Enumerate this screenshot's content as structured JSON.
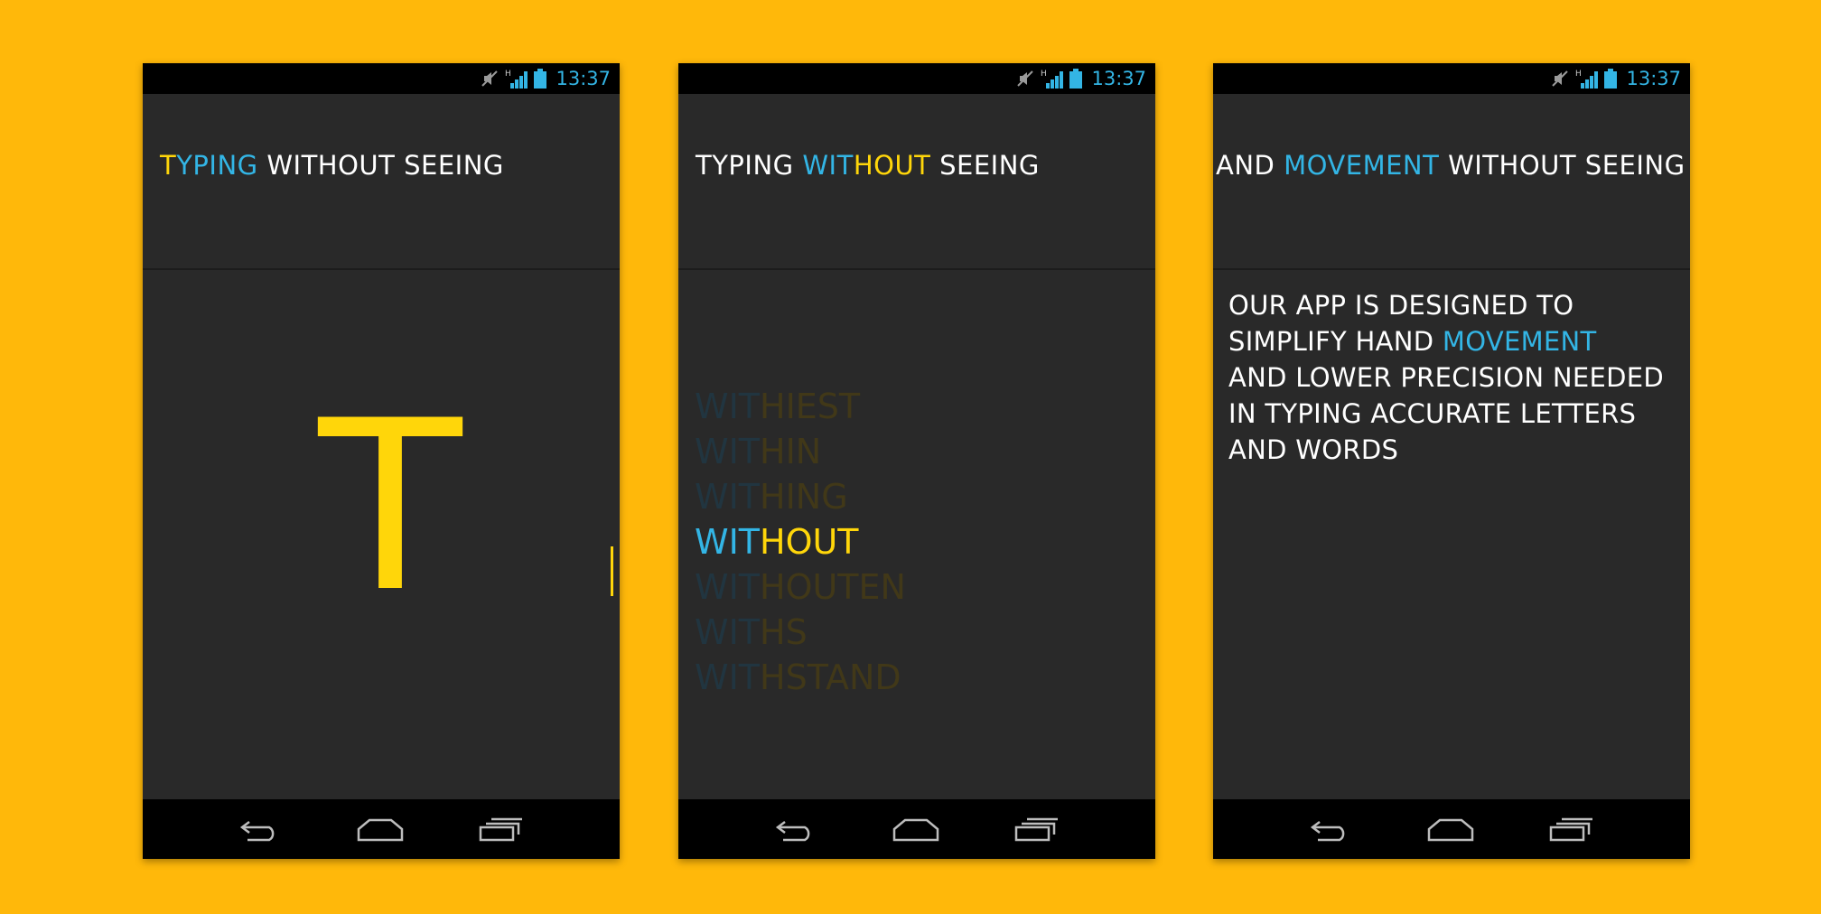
{
  "phones": [
    {
      "status": {
        "time": "13:37"
      },
      "title": {
        "pre": "T",
        "hl": "YPING",
        "post": " WITHOUT SEEING"
      },
      "big_letter": "T"
    },
    {
      "status": {
        "time": "13:37"
      },
      "title": {
        "pre": "TYPING ",
        "hl1": "WIT",
        "hl2": "HOUT",
        "post": " SEEING"
      },
      "suggestions": [
        {
          "prefix": "WIT",
          "suffix": "HIEST",
          "active": false
        },
        {
          "prefix": "WIT",
          "suffix": "HIN",
          "active": false
        },
        {
          "prefix": "WIT",
          "suffix": "HING",
          "active": false
        },
        {
          "prefix": "WIT",
          "suffix": "HOUT",
          "active": true
        },
        {
          "prefix": "WIT",
          "suffix": "HOUTEN",
          "active": false
        },
        {
          "prefix": "WIT",
          "suffix": "HS",
          "active": false
        },
        {
          "prefix": "WIT",
          "suffix": "HSTAND",
          "active": false
        }
      ]
    },
    {
      "status": {
        "time": "13:37"
      },
      "title": {
        "pre": "AND ",
        "hl": "MOVEMENT",
        "post": " WITHOUT SEEING"
      },
      "body": {
        "line1": "OUR APP IS DESIGNED TO",
        "line2_pre": "SIMPLIFY HAND ",
        "line2_hl": "MOVEMENT",
        "line3": "AND LOWER PRECISION NEEDED",
        "line4": "IN TYPING ACCURATE LETTERS",
        "line5": "AND WORDS"
      }
    }
  ],
  "icons": {
    "mute": "mute-icon",
    "signal": "signal-icon",
    "battery": "battery-icon",
    "back": "back-icon",
    "home": "home-icon",
    "recents": "recent-apps-icon"
  },
  "colors": {
    "background": "#FFB80A",
    "accent_blue": "#33B5E5",
    "accent_yellow": "#FFD60A",
    "screen": "#292929"
  }
}
